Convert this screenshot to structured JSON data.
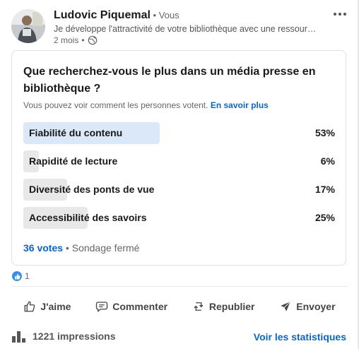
{
  "post": {
    "author_name": "Ludovic Piquemal",
    "author_separator": " • ",
    "author_relation": "Vous",
    "headline": "Je développe l'attractivité de votre bibliothèque avec une ressource presse",
    "age": "2 mois",
    "age_separator": "•",
    "visibility_icon": "globe-icon",
    "menu_icon": "more-horizontal-icon",
    "avatar_icon": "profile-photo"
  },
  "poll": {
    "question": "Que recherchez-vous le plus dans un média presse en bibliothèque ?",
    "visibility_note": "Vous pouvez voir comment les personnes votent.",
    "learn_more": "En savoir plus",
    "options": [
      {
        "label": "Fiabilité du contenu",
        "percent": "53%",
        "value": 53,
        "selected": true
      },
      {
        "label": "Rapidité de lecture",
        "percent": "6%",
        "value": 6,
        "selected": false
      },
      {
        "label": "Diversité des ponts de vue",
        "percent": "17%",
        "value": 17,
        "selected": false
      },
      {
        "label": "Accessibilité des savoirs",
        "percent": "25%",
        "value": 25,
        "selected": false
      }
    ],
    "votes": "36 votes",
    "status_separator": "•",
    "status": "Sondage fermé"
  },
  "reactions": {
    "icon": "like-reaction-icon",
    "count": "1"
  },
  "actions": {
    "like": {
      "label": "J'aime",
      "icon": "thumbs-up-icon"
    },
    "comment": {
      "label": "Commenter",
      "icon": "comment-icon"
    },
    "repost": {
      "label": "Republier",
      "icon": "repost-icon"
    },
    "send": {
      "label": "Envoyer",
      "icon": "send-icon"
    }
  },
  "analytics": {
    "icon": "bar-chart-icon",
    "impressions": "1221 impressions",
    "stats_link": "Voir les statistiques"
  },
  "colors": {
    "link_blue": "#0a66c2",
    "selected_bar": "#dbe8f8",
    "bar": "#e8e8e8",
    "like_badge": "#378fe9"
  }
}
